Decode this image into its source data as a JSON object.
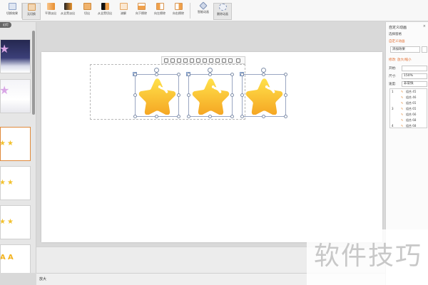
{
  "ribbon": {
    "buttons": [
      {
        "label": "切换效果",
        "icon": "switch-effect-icon"
      },
      {
        "label": "无切换",
        "icon": "no-transition-icon"
      },
      {
        "label": "平滑淡出",
        "icon": "smooth-fade-icon"
      },
      {
        "label": "从全黑淡出",
        "icon": "fade-from-black-icon"
      },
      {
        "label": "切出",
        "icon": "cut-out-icon"
      },
      {
        "label": "从全黑切出",
        "icon": "cut-from-black-icon"
      },
      {
        "label": "溶解",
        "icon": "dissolve-icon"
      },
      {
        "label": "向下擦除",
        "icon": "wipe-down-icon"
      },
      {
        "label": "向左擦除",
        "icon": "wipe-left-icon"
      },
      {
        "label": "向右擦除",
        "icon": "wipe-right-icon"
      },
      {
        "label": "智能动画",
        "icon": "smart-animation-icon"
      },
      {
        "label": "删除动画",
        "icon": "delete-animation-icon"
      }
    ]
  },
  "left_panel": {
    "tab_label": "幻灯"
  },
  "status": {
    "text": "放大"
  },
  "right_pane": {
    "title": "自定义动画",
    "close": "×",
    "select_pane": "选择窗格",
    "section": "自定义动画",
    "add_effect": "添加效果",
    "modify": "修改: 放大/缩小",
    "start_label": "开始:",
    "start_value": "",
    "size_label": "尺寸:",
    "size_value": "150%",
    "speed_label": "速度:",
    "speed_value": "非常快",
    "animations": [
      {
        "num": "1",
        "name": "组合 45"
      },
      {
        "num": "",
        "name": "组合 46"
      },
      {
        "num": "",
        "name": "组合 65"
      },
      {
        "num": "3",
        "name": "组合 65"
      },
      {
        "num": "",
        "name": "组合 66"
      },
      {
        "num": "",
        "name": "组合 68"
      },
      {
        "num": "4",
        "name": "组合 68"
      }
    ]
  },
  "watermark": {
    "text": "软件技巧"
  },
  "colors": {
    "star_top": "#ffe14a",
    "star_bottom": "#f5a623",
    "accent": "#e06a2b"
  }
}
